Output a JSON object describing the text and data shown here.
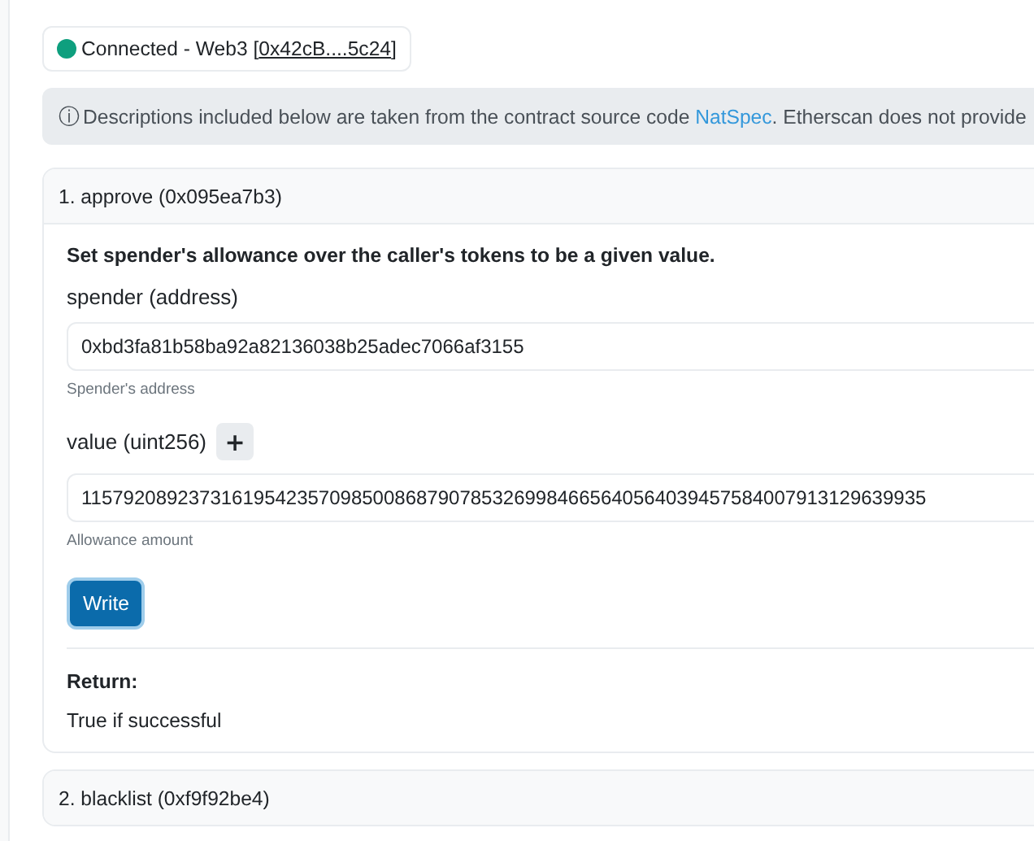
{
  "connection": {
    "status": "Connected - Web3 [",
    "address": "0x42cB....5c24",
    "closing": "]",
    "color": "#0e9f7e"
  },
  "notice": {
    "icon": "ⓘ",
    "text": "Descriptions included below are taken from the contract source code ",
    "link": "NatSpec",
    "rest": ". Etherscan does not provide"
  },
  "functions": [
    {
      "title": "1. approve (0x095ea7b3)",
      "expanded": true,
      "description": "Set spender's allowance over the caller's tokens to be a given value.",
      "inputs": [
        {
          "label": "spender (address)",
          "value": "0xbd3fa81b58ba92a82136038b25adec7066af3155",
          "hint": "Spender's address"
        },
        {
          "label": "value (uint256)",
          "expand_button": "+",
          "value": "115792089237316195423570985008687907853269984665640564039457584007913129639935",
          "hint": "Allowance amount"
        }
      ],
      "button": "Write",
      "return_label": "Return:",
      "return_text": "True if successful"
    },
    {
      "title": "2. blacklist (0xf9f92be4)",
      "expanded": false
    }
  ]
}
